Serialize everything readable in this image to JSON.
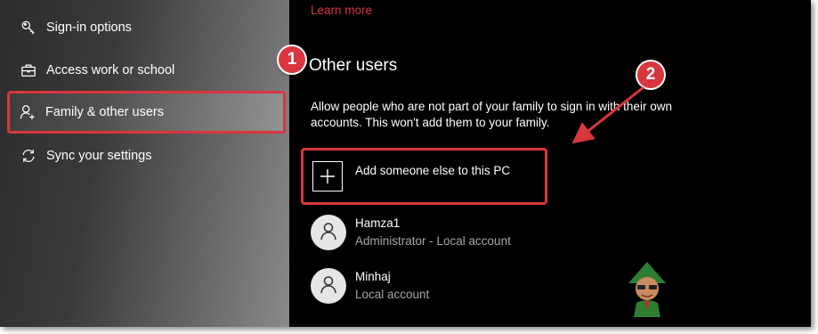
{
  "sidebar": {
    "items": [
      {
        "label": "Sign-in options",
        "icon": "key-icon"
      },
      {
        "label": "Access work or school",
        "icon": "briefcase-icon"
      },
      {
        "label": "Family & other users",
        "icon": "person-add-icon",
        "selected": true
      },
      {
        "label": "Sync your settings",
        "icon": "sync-icon"
      }
    ]
  },
  "main": {
    "learn_more": "Learn more",
    "section_title": "Other users",
    "description": "Allow people who are not part of your family to sign in with their own accounts. This won't add them to your family.",
    "add_button_label": "Add someone else to this PC",
    "users": [
      {
        "name": "Hamza1",
        "subtitle": "Administrator - Local account"
      },
      {
        "name": "Minhaj",
        "subtitle": "Local account"
      }
    ]
  },
  "annotations": {
    "badge_1": "1",
    "badge_2": "2"
  },
  "colors": {
    "accent": "#d9363e",
    "main_background": "#000000",
    "sidebar_background": "#3a3a3a"
  }
}
